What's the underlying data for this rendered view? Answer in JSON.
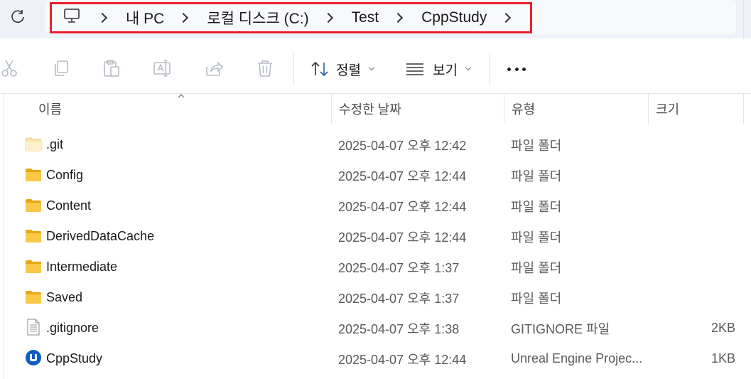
{
  "address_bar": {
    "breadcrumbs": [
      "내 PC",
      "로컬 디스크 (C:)",
      "Test",
      "CppStudy"
    ]
  },
  "toolbar": {
    "sort_label": "정렬",
    "view_label": "보기"
  },
  "columns": {
    "name": "이름",
    "modified": "수정한 날짜",
    "type": "유형",
    "size": "크기"
  },
  "files": [
    {
      "name": ".git",
      "modified": "2025-04-07 오후 12:42",
      "type": "파일 폴더",
      "size": "",
      "icon": "folder-hidden-icon"
    },
    {
      "name": "Config",
      "modified": "2025-04-07 오후 12:44",
      "type": "파일 폴더",
      "size": "",
      "icon": "folder-icon"
    },
    {
      "name": "Content",
      "modified": "2025-04-07 오후 12:44",
      "type": "파일 폴더",
      "size": "",
      "icon": "folder-icon"
    },
    {
      "name": "DerivedDataCache",
      "modified": "2025-04-07 오후 12:44",
      "type": "파일 폴더",
      "size": "",
      "icon": "folder-icon"
    },
    {
      "name": "Intermediate",
      "modified": "2025-04-07 오후 1:37",
      "type": "파일 폴더",
      "size": "",
      "icon": "folder-icon"
    },
    {
      "name": "Saved",
      "modified": "2025-04-07 오후 1:37",
      "type": "파일 폴더",
      "size": "",
      "icon": "folder-icon"
    },
    {
      "name": ".gitignore",
      "modified": "2025-04-07 오후 1:38",
      "type": "GITIGNORE 파일",
      "size": "2KB",
      "icon": "text-file-icon"
    },
    {
      "name": "CppStudy",
      "modified": "2025-04-07 오후 12:44",
      "type": "Unreal Engine Projec...",
      "size": "1KB",
      "icon": "unreal-engine-icon"
    }
  ],
  "colors": {
    "highlight_border": "#e8202a",
    "folder_yellow": "#f8c846",
    "unreal_blue": "#0f5cc4"
  }
}
